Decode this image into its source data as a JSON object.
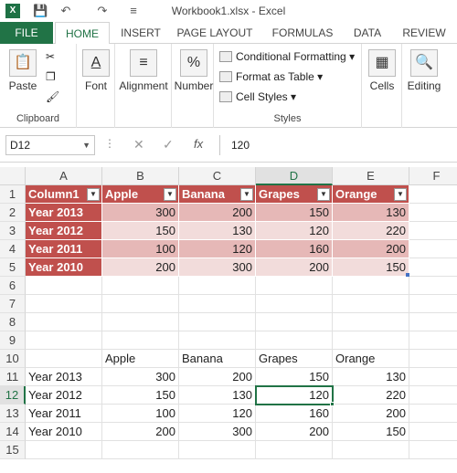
{
  "window": {
    "title": "Workbook1.xlsx - Excel",
    "logo": "X",
    "qat": [
      "save-icon",
      "undo-icon",
      "redo-icon",
      "customize-icon"
    ]
  },
  "tabs": [
    "FILE",
    "HOME",
    "INSERT",
    "PAGE LAYOUT",
    "FORMULAS",
    "DATA",
    "REVIEW"
  ],
  "ribbon": {
    "clipboard": {
      "label": "Clipboard",
      "paste": "Paste"
    },
    "font": "Font",
    "alignment": "Alignment",
    "number": "Number",
    "styles": {
      "label": "Styles",
      "conditional": "Conditional Formatting",
      "format_table": "Format as Table",
      "cell_styles": "Cell Styles"
    },
    "cells": "Cells",
    "editing": "Editing"
  },
  "formula_bar": {
    "name_box": "D12",
    "value": "120",
    "fx": "fx"
  },
  "columns": [
    "A",
    "B",
    "C",
    "D",
    "E",
    "F"
  ],
  "rows": [
    "1",
    "2",
    "3",
    "4",
    "5",
    "6",
    "7",
    "8",
    "9",
    "10",
    "11",
    "12",
    "13",
    "14",
    "15"
  ],
  "table": {
    "headers": [
      "Column1",
      "Apple",
      "Banana",
      "Grapes",
      "Orange"
    ],
    "rows": [
      [
        "Year 2013",
        "300",
        "200",
        "150",
        "130"
      ],
      [
        "Year 2012",
        "150",
        "130",
        "120",
        "220"
      ],
      [
        "Year 2011",
        "100",
        "120",
        "160",
        "200"
      ],
      [
        "Year 2010",
        "200",
        "300",
        "200",
        "150"
      ]
    ]
  },
  "range": {
    "headers": [
      "Apple",
      "Banana",
      "Grapes",
      "Orange"
    ],
    "rows": [
      [
        "Year 2013",
        "300",
        "200",
        "150",
        "130"
      ],
      [
        "Year 2012",
        "150",
        "130",
        "120",
        "220"
      ],
      [
        "Year 2011",
        "100",
        "120",
        "160",
        "200"
      ],
      [
        "Year 2010",
        "200",
        "300",
        "200",
        "150"
      ]
    ]
  },
  "selection": {
    "cell": "D12",
    "column": "D",
    "row": "12"
  },
  "colors": {
    "accent": "#217346",
    "table_header": "#c0504d",
    "band1": "#e6b8b7",
    "band2": "#f2dcdb"
  }
}
